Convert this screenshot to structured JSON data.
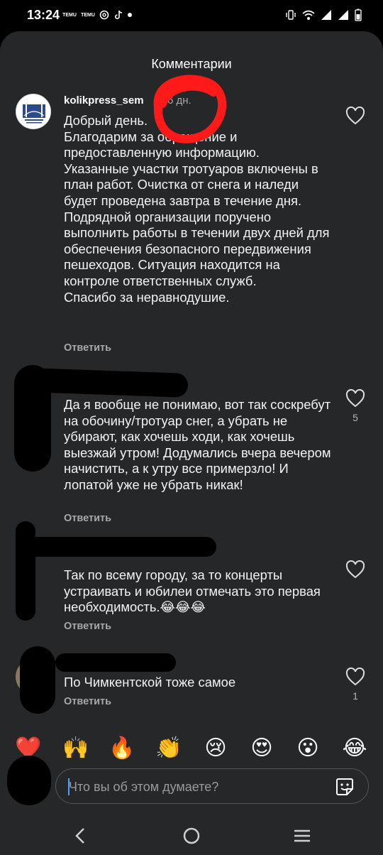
{
  "status_bar": {
    "time": "13:24",
    "left_icons": [
      "temu-icon",
      "temu-icon",
      "threads-icon",
      "tiktok-icon",
      "notification-dot"
    ],
    "temu_label": "TEMU",
    "right_icons": [
      "vibrate-icon",
      "wifi-icon",
      "signal-icon",
      "signal-icon",
      "battery-icon"
    ]
  },
  "sheet": {
    "title": "Комментарии"
  },
  "comments": [
    {
      "username": "kolikpress_sem",
      "time": "6 дн.",
      "text": "Добрый день.\nБлагодарим за обращение и предоставленную информацию.\nУказанные участки тротуаров включены в план работ. Очистка от снега и наледи будет проведена завтра в течение дня.\nПодрядной организации поручено выполнить работы в течении двух дней для обеспечения безопасного передвижения пешеходов. Ситуация находится на контроле ответственных служб.\nСпасибо за неравнодушие.",
      "reply": "Ответить",
      "likes": ""
    },
    {
      "username": "",
      "time": "",
      "text": "Да я вообще не понимаю, вот так соскребут на обочину/тротуар снег, а убрать не убирают, как хочешь ходи, как хочешь выезжай утром! Додумались вчера вечером начистить, а к утру все примерзло! И лопатой уже не убрать никак!",
      "reply": "Ответить",
      "likes": "5"
    },
    {
      "username": "",
      "time": "",
      "text": "Так по всему городу, за то концерты устраивать и юбилеи отмечать это первая необходимость.😂😂😂",
      "reply": "Ответить",
      "likes": ""
    },
    {
      "username": "",
      "time": "",
      "text": "По Чимкентской тоже самое",
      "reply": "Ответить",
      "likes": "1"
    }
  ],
  "reactions": [
    "❤️",
    "🙌",
    "🔥",
    "👏",
    "😢",
    "😍",
    "😮",
    "😂"
  ],
  "composer": {
    "placeholder": "Что вы об этом думаете?",
    "value": ""
  },
  "nav": {
    "icons": [
      "back-icon",
      "home-icon",
      "recents-icon"
    ]
  },
  "colors": {
    "sheet_bg": "#262729",
    "annotation_red": "#ff1a1a",
    "redaction": "#000000"
  }
}
